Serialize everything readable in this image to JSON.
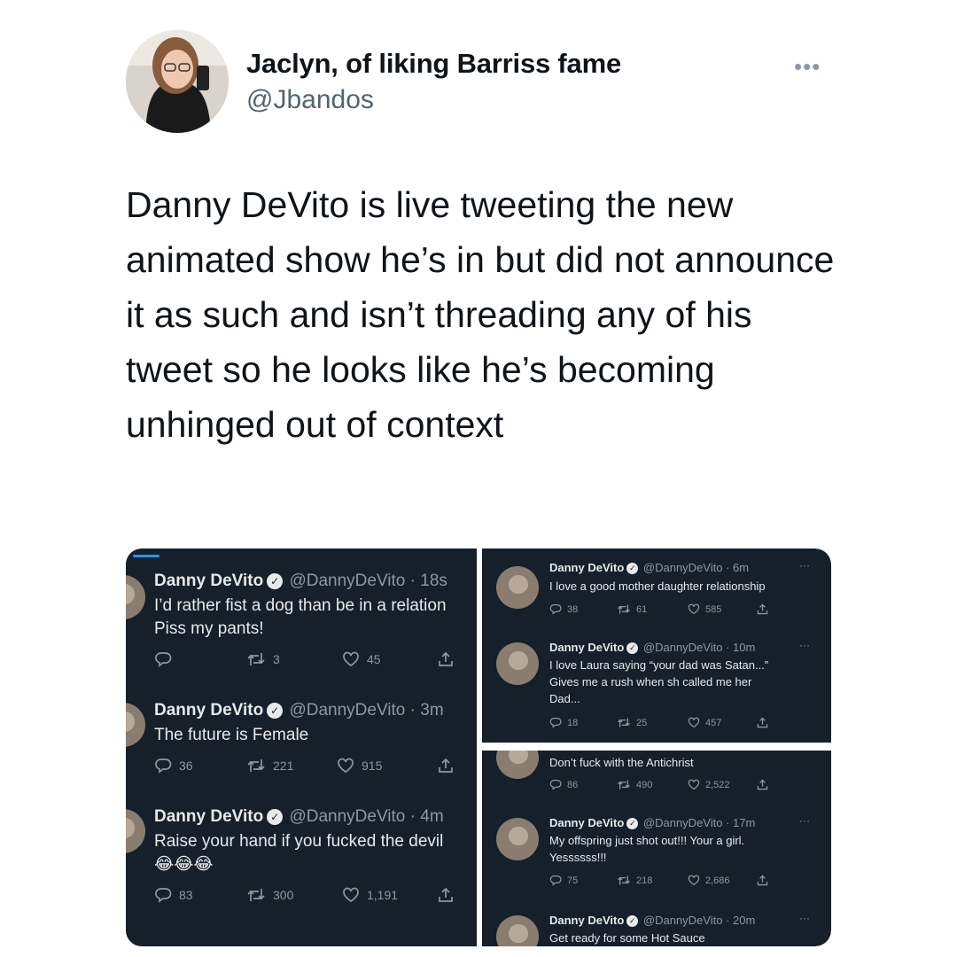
{
  "tweet": {
    "author_name": "Jaclyn, of liking Barriss fame",
    "author_handle": "@Jbandos",
    "more_label": "•••",
    "text": "Danny DeVito is live tweeting the new animated show he’s in but did not announce it as such and isn’t threading any of his tweet so he looks like he’s becoming unhinged out of context"
  },
  "left_tweets": [
    {
      "name": "Danny DeVito",
      "handle_time": "@DannyDeVito · 18s",
      "line1": "I’d rather fist a dog than be in a relation",
      "line2": "Piss my pants!",
      "reply": "",
      "retweet": "3",
      "like": "45"
    },
    {
      "name": "Danny DeVito",
      "handle_time": "@DannyDeVito · 3m",
      "line1": "The future is Female",
      "line2": "",
      "reply": "36",
      "retweet": "221",
      "like": "915"
    },
    {
      "name": "Danny DeVito",
      "handle_time": "@DannyDeVito · 4m",
      "line1": "Raise your hand if you fucked the devil",
      "line2": "😂😂😂",
      "reply": "83",
      "retweet": "300",
      "like": "1,191"
    }
  ],
  "right_tweets": [
    {
      "name": "Danny DeVito",
      "handle_time": "@DannyDeVito · 6m",
      "line1": "I love a good mother daughter relationship",
      "line2": "",
      "line3": "",
      "reply": "38",
      "retweet": "61",
      "like": "585"
    },
    {
      "name": "Danny DeVito",
      "handle_time": "@DannyDeVito · 10m",
      "line1": "I love Laura saying “your dad was Satan...”",
      "line2": "Gives me a rush when sh called me her",
      "line3": "Dad...",
      "reply": "18",
      "retweet": "25",
      "like": "457"
    },
    {
      "name": "",
      "handle_time": "",
      "line1": "Don’t fuck with the Antichrist",
      "line2": "",
      "line3": "",
      "reply": "86",
      "retweet": "490",
      "like": "2,522"
    },
    {
      "name": "Danny DeVito",
      "handle_time": "@DannyDeVito · 17m",
      "line1": "My offspring just shot out!!! Your a girl.",
      "line2": "Yessssss!!!",
      "line3": "",
      "reply": "75",
      "retweet": "218",
      "like": "2,686"
    },
    {
      "name": "Danny DeVito",
      "handle_time": "@DannyDeVito · 20m",
      "line1": "Get ready for some Hot Sauce",
      "line2": "",
      "line3": "",
      "reply": "",
      "retweet": "",
      "like": ""
    }
  ],
  "colors": {
    "dark_bg": "#15202b",
    "text_light": "#e7e9ea",
    "text_muted": "#8b98a5",
    "accent": "#1d9bf0"
  }
}
